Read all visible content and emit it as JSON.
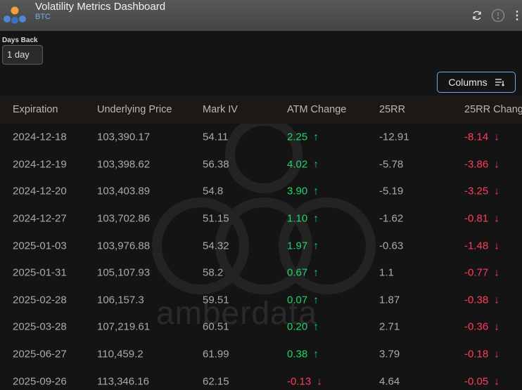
{
  "header": {
    "title": "Volatility Metrics Dashboard",
    "asset": "BTC",
    "icons": [
      "refresh-icon",
      "info-icon",
      "more-vertical-icon"
    ]
  },
  "controls": {
    "days_back_label": "Days Back",
    "days_back_value": "1 day",
    "columns_label": "Columns"
  },
  "watermark_text": "amberdata",
  "colors": {
    "positive": "#1ed66a",
    "negative": "#ff3c5a",
    "accent": "#6ea8ee",
    "asset": "#78aaf0"
  },
  "table": {
    "columns": [
      "Expiration",
      "Underlying Price",
      "Mark IV",
      "ATM Change",
      "25RR",
      "25RR Chang"
    ],
    "rows": [
      {
        "expiration": "2024-12-18",
        "price": "103,390.17",
        "mark_iv": "54.11",
        "atm_change": "2.25",
        "atm_dir": "up",
        "rr25": "-12.91",
        "rr25_change": "-8.14",
        "rr_dir": "down"
      },
      {
        "expiration": "2024-12-19",
        "price": "103,398.62",
        "mark_iv": "56.38",
        "atm_change": "4.02",
        "atm_dir": "up",
        "rr25": "-5.78",
        "rr25_change": "-3.86",
        "rr_dir": "down"
      },
      {
        "expiration": "2024-12-20",
        "price": "103,403.89",
        "mark_iv": "54.8",
        "atm_change": "3.90",
        "atm_dir": "up",
        "rr25": "-5.19",
        "rr25_change": "-3.25",
        "rr_dir": "down"
      },
      {
        "expiration": "2024-12-27",
        "price": "103,702.86",
        "mark_iv": "51.15",
        "atm_change": "1.10",
        "atm_dir": "up",
        "rr25": "-1.62",
        "rr25_change": "-0.81",
        "rr_dir": "down"
      },
      {
        "expiration": "2025-01-03",
        "price": "103,976.88",
        "mark_iv": "54.32",
        "atm_change": "1.97",
        "atm_dir": "up",
        "rr25": "-0.63",
        "rr25_change": "-1.48",
        "rr_dir": "down"
      },
      {
        "expiration": "2025-01-31",
        "price": "105,107.93",
        "mark_iv": "58.2",
        "atm_change": "0.67",
        "atm_dir": "up",
        "rr25": "1.1",
        "rr25_change": "-0.77",
        "rr_dir": "down"
      },
      {
        "expiration": "2025-02-28",
        "price": "106,157.3",
        "mark_iv": "59.51",
        "atm_change": "0.07",
        "atm_dir": "up",
        "rr25": "1.87",
        "rr25_change": "-0.38",
        "rr_dir": "down"
      },
      {
        "expiration": "2025-03-28",
        "price": "107,219.61",
        "mark_iv": "60.51",
        "atm_change": "0.20",
        "atm_dir": "up",
        "rr25": "2.71",
        "rr25_change": "-0.36",
        "rr_dir": "down"
      },
      {
        "expiration": "2025-06-27",
        "price": "110,459.2",
        "mark_iv": "61.99",
        "atm_change": "0.38",
        "atm_dir": "up",
        "rr25": "3.79",
        "rr25_change": "-0.18",
        "rr_dir": "down"
      },
      {
        "expiration": "2025-09-26",
        "price": "113,346.16",
        "mark_iv": "62.15",
        "atm_change": "-0.13",
        "atm_dir": "down",
        "rr25": "4.64",
        "rr25_change": "-0.05",
        "rr_dir": "down"
      }
    ]
  }
}
